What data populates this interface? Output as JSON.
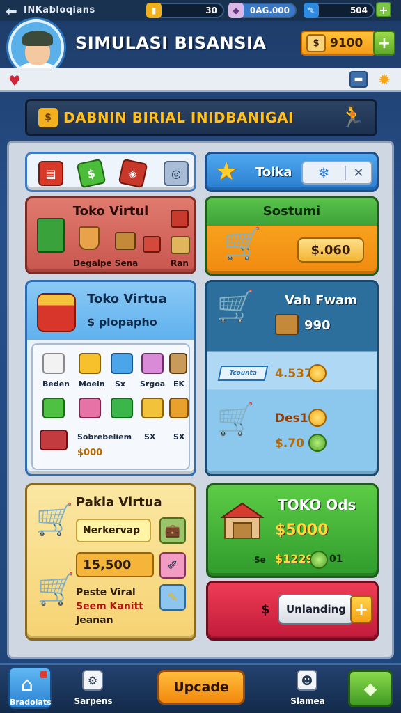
{
  "status_bar": {
    "title": "INKabloqians",
    "resource1": "30",
    "resource2": "0AG.000",
    "resource3": "504"
  },
  "header": {
    "game_title": "SIMULASI BISANSIA",
    "coins": "9100"
  },
  "banner": {
    "text": "DABNIN BIRIAL INIDBANIGAI"
  },
  "toko_bar": {
    "title": "Toika"
  },
  "toko_virtual_red": {
    "title": "Toko Virtul",
    "sub_left": "Degalpe Sena",
    "sub_right": "Ran"
  },
  "sostumi": {
    "title": "Sostumi",
    "price": "$.060"
  },
  "toko_virtua_blue": {
    "title": "Toko Virtua",
    "subtitle": "$ plopapho",
    "items": [
      "Beden",
      "Moein",
      "Sx",
      "Srgoa",
      "EK",
      "Sobrebeliem",
      "SX",
      "SX"
    ],
    "price": "$000"
  },
  "vah_fwam": {
    "title": "Vah Fwam",
    "value": "990",
    "ticket": "Tcounta",
    "price1": "4.537",
    "price2": "Des1",
    "price3": "$.70"
  },
  "pakla": {
    "title": "Pakla Virtua",
    "field1": "Nerkervap",
    "field2": "15,500",
    "line1": "Peste Viral",
    "line2": "Seem Kanitt",
    "line3": "Jeanan"
  },
  "toko_ods": {
    "title": "TOKO Ods",
    "price": "$5000",
    "small1": "Se",
    "small2": "$1229",
    "small3": "01"
  },
  "upgrade_card": {
    "symbol": "$",
    "button": "Unlanding"
  },
  "bottom_nav": {
    "home": "Bradoiats",
    "shop": "Sarpens",
    "update": "Upcade",
    "stats": "Slamea"
  }
}
